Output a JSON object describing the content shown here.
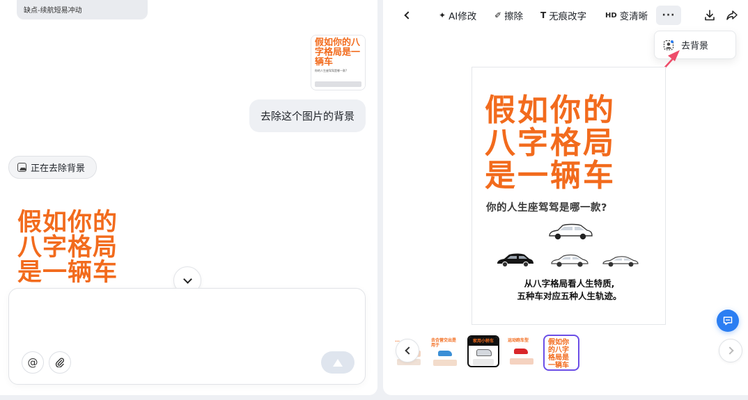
{
  "chat": {
    "top_snippet": "缺点-续航短易冲动",
    "sent_image_title": "假如你的八字格局是一辆车",
    "sent_image_subtitle": "你的人生座驾驾是哪一款?",
    "user_message": "去除这个图片的背景",
    "status_chip": "正在去除背景",
    "result_title_lines": [
      "假如你的",
      "八字格局",
      "是一辆车"
    ],
    "composer": {
      "placeholder": "",
      "value": ""
    }
  },
  "preview": {
    "toolbar": {
      "ai_edit": "AI修改",
      "erase": "擦除",
      "text_edit": "无痕改字",
      "hd_label": "HD",
      "enhance": "变清晰",
      "more": "···"
    },
    "menu": {
      "remove_background": "去背景"
    },
    "poster": {
      "title_lines": [
        "假如你的",
        "八字格局",
        "是一辆车"
      ],
      "subtitle": "你的人生座驾驾是哪一款?",
      "desc_lines": [
        "从八字格局看人生特质,",
        "五种车对应五种人生轨迹。"
      ]
    },
    "thumbnails": [
      {
        "label": "..."
      },
      {
        "label": "去合营交出是用于"
      },
      {
        "label": "家用小轿车"
      },
      {
        "label": "运动跑车型"
      },
      {
        "label": "假如你的八字格局是一辆车"
      }
    ]
  },
  "colors": {
    "accent_orange": "#f26b1d",
    "selection_purple": "#6b4ee6",
    "fab_blue": "#2b7ef2",
    "annotation_arrow": "#ee4d6a"
  }
}
